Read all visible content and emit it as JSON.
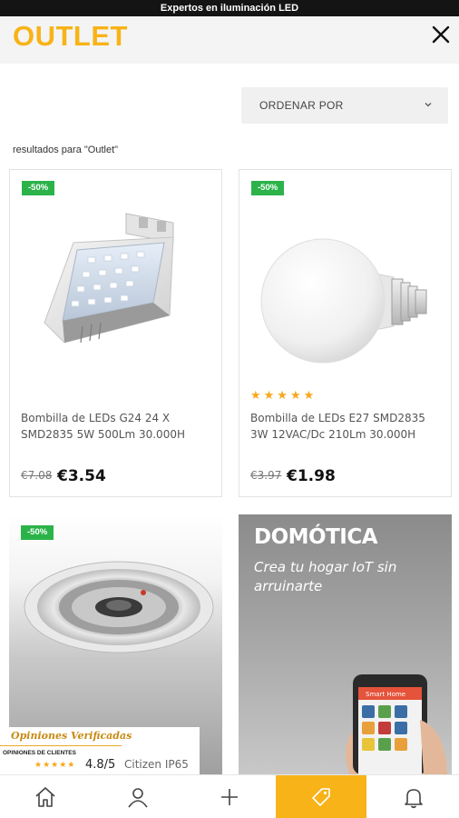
{
  "top_banner": {
    "text": "Expertos en iluminación LED"
  },
  "header": {
    "title": "OUTLET",
    "close_icon": "close-icon"
  },
  "sort": {
    "label": "ORDENAR POR",
    "icon": "chevron-down-icon"
  },
  "results_text": "resultados para \"Outlet\"",
  "products": [
    {
      "badge": "-50%",
      "name_line1": "Bombilla de LEDs G24 24 X",
      "name_line2": "SMD2835 5W 500Lm 30.000H",
      "old_price": "€7.08",
      "price": "€3.54",
      "rating": 0
    },
    {
      "badge": "-50%",
      "name_line1": "Bombilla de LEDs E27 SMD2835",
      "name_line2": "3W 12VAC/Dc 210Lm 30.000H",
      "old_price": "€3.97",
      "price": "€1.98",
      "rating": 5,
      "stars": "★★★★★"
    },
    {
      "badge": "-50%",
      "name_partial": "Citizen IP65"
    }
  ],
  "promo_banner": {
    "title": "DOMÓTICA",
    "subtitle": "Crea tu hogar IoT sin arruinarte",
    "phone_text": "Smart Home"
  },
  "reviews_badge": {
    "title": "Opiniones Verificadas",
    "subtitle": "OPINIONES DE CLIENTES",
    "stars": "★★★★★",
    "score": "4.8/5"
  },
  "bottom_nav": [
    {
      "icon": "home-icon",
      "active": false
    },
    {
      "icon": "user-icon",
      "active": false
    },
    {
      "icon": "plus-icon",
      "active": false
    },
    {
      "icon": "tag-icon",
      "active": true
    },
    {
      "icon": "bell-icon",
      "active": false
    }
  ],
  "colors": {
    "brand": "#f7b318",
    "badge_green": "#2bb34a",
    "star": "#f7a81b"
  }
}
